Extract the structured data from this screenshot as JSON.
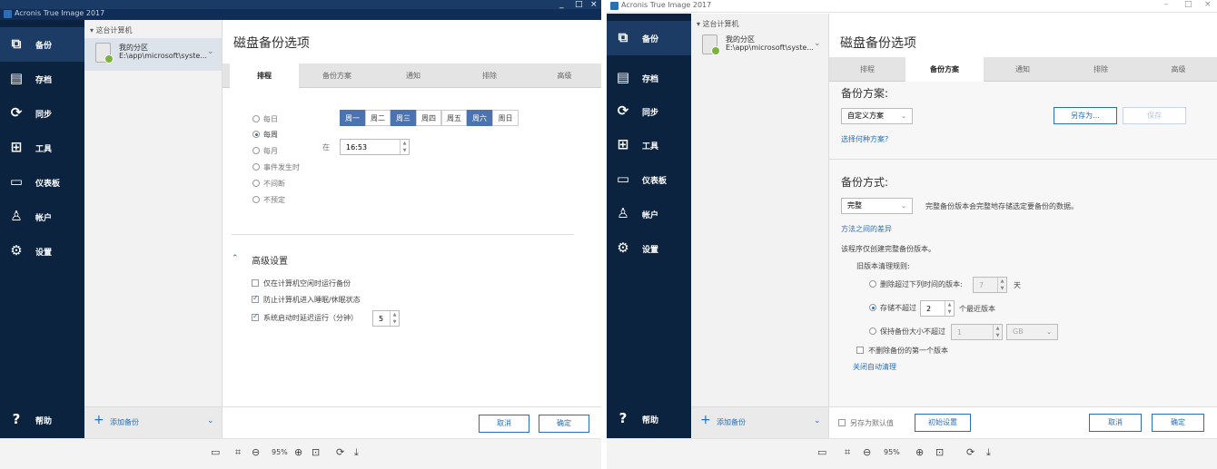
{
  "app_title": "Acronis True Image 2017",
  "nav": [
    {
      "label": "备份",
      "icon": "backup-icon"
    },
    {
      "label": "存档",
      "icon": "archive-icon"
    },
    {
      "label": "同步",
      "icon": "sync-icon"
    },
    {
      "label": "工具",
      "icon": "tools-icon"
    },
    {
      "label": "仪表板",
      "icon": "dashboard-icon"
    },
    {
      "label": "帐户",
      "icon": "account-icon"
    },
    {
      "label": "设置",
      "icon": "settings-icon"
    }
  ],
  "help_label": "帮助",
  "tree_header": "这台计算机",
  "source": {
    "name": "我的分区",
    "path": "E:\\app\\microsoft\\syste..."
  },
  "add_backup": "添加备份",
  "page_title": "磁盘备份选项",
  "tabs": [
    "排程",
    "备份方案",
    "通知",
    "排除",
    "高级"
  ],
  "schedule": {
    "options": [
      "每日",
      "每周",
      "每月",
      "事件发生时",
      "不间断",
      "不预定"
    ],
    "selected": "每周",
    "days": [
      "周一",
      "周二",
      "周三",
      "周四",
      "周五",
      "周六",
      "周日"
    ],
    "days_selected": [
      "周一",
      "周三",
      "周六"
    ],
    "at_label": "在",
    "time": "16:53"
  },
  "advanced": {
    "title": "高级设置",
    "items": [
      {
        "label": "仅在计算机空闲时运行备份",
        "checked": false
      },
      {
        "label": "防止计算机进入睡眠/休眠状态",
        "checked": true
      },
      {
        "label": "系统启动时延迟运行（分钟）",
        "checked": true
      }
    ],
    "delay_value": "5"
  },
  "buttons": {
    "cancel": "取消",
    "ok": "确定",
    "save_default": "另存为默认值",
    "initial": "初始设置"
  },
  "scheme": {
    "section_title": "备份方案:",
    "selected": "自定义方案",
    "save_as": "另存为...",
    "save": "保存",
    "which_link": "选择何种方案?",
    "method_title": "备份方式:",
    "method": "完整",
    "method_desc": "完整备份版本会完整地存储选定要备份的数据。",
    "diff_link": "方法之间的差异",
    "note": "该程序仅创建完整备份版本。",
    "cleanup_title": "旧版本清理规则:",
    "rule1": "删除超过下列时间的版本:",
    "rule1_value": "7",
    "rule1_unit": "天",
    "rule2": "存储不超过",
    "rule2_value": "2",
    "rule2_unit": "个最近版本",
    "rule3": "保持备份大小不超过",
    "rule3_value": "1",
    "rule3_unit": "GB",
    "keep_first": "不删除备份的第一个版本",
    "off_link": "关闭自动清理"
  },
  "viewer": {
    "zoom": "95%"
  }
}
